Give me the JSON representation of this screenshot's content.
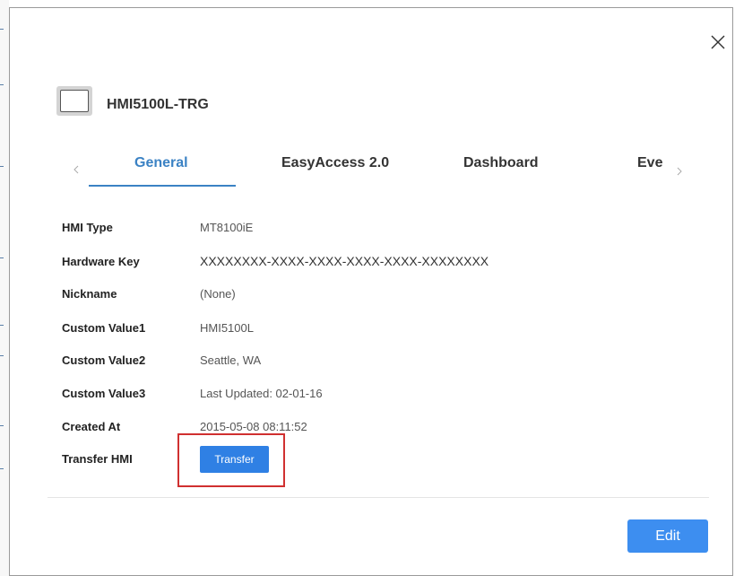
{
  "device": {
    "icon": "device-screen-icon",
    "name": "HMI5100L-TRG"
  },
  "tabs": [
    {
      "label": "General",
      "active": true
    },
    {
      "label": "EasyAccess 2.0",
      "active": false
    },
    {
      "label": "Dashboard",
      "active": false
    },
    {
      "label": "Eve",
      "active": false
    }
  ],
  "details": [
    {
      "label": "HMI Type",
      "value": "MT8100iE"
    },
    {
      "label": "Hardware Key",
      "value": "XXXXXXXX-XXXX-XXXX-XXXX-XXXX-XXXXXXXX"
    },
    {
      "label": "Nickname",
      "value": "(None)"
    },
    {
      "label": "Custom Value1",
      "value": "HMI5100L"
    },
    {
      "label": "Custom Value2",
      "value": "Seattle, WA"
    },
    {
      "label": "Custom Value3",
      "value": "Last Updated: 02-01-16"
    },
    {
      "label": "Created At",
      "value": "2015-05-08 08:11:52"
    },
    {
      "label": "Transfer HMI",
      "button": "Transfer"
    }
  ],
  "footer": {
    "edit_label": "Edit"
  },
  "colors": {
    "accent": "#3b82c4",
    "button": "#2f80e4",
    "highlight": "#d03030"
  }
}
